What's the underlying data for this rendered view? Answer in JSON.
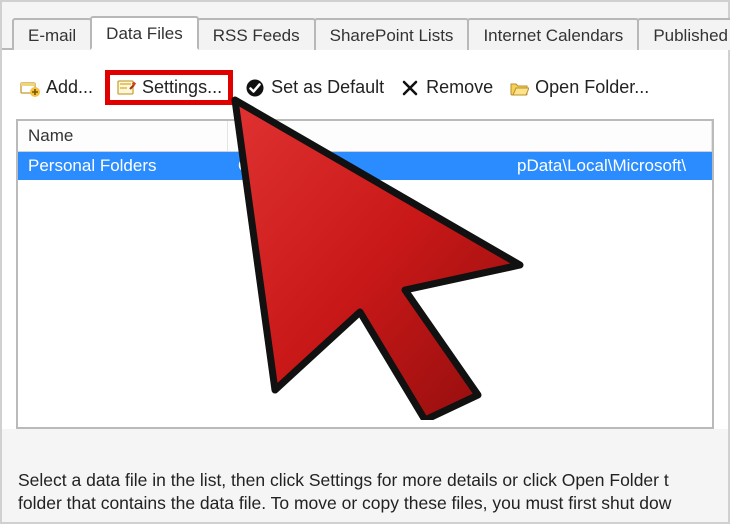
{
  "tabs": {
    "email": "E-mail",
    "data_files": "Data Files",
    "rss": "RSS Feeds",
    "sharepoint": "SharePoint Lists",
    "calendars": "Internet Calendars",
    "published": "Published Ca"
  },
  "toolbar": {
    "add": "Add...",
    "settings": "Settings...",
    "default": "Set as Default",
    "remove": "Remove",
    "open_folder": "Open Folder..."
  },
  "list": {
    "header_name": "Name",
    "row1": {
      "name": "Personal Folders",
      "loc": "O",
      "path": "pData\\Local\\Microsoft\\"
    }
  },
  "footer": "Select a data file in the list, then click Settings for more details or click Open Folder t\nfolder that contains the data file. To move or copy these files, you must first shut dow"
}
